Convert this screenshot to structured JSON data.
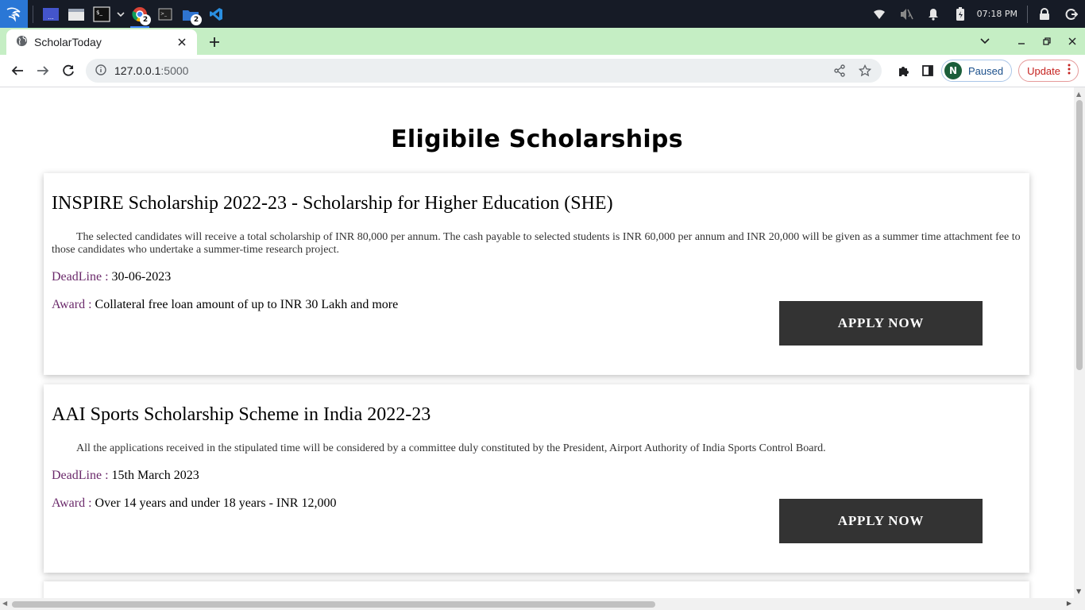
{
  "taskbar": {
    "clock": "07:18 PM",
    "apps": [
      {
        "name": "workspace-switcher",
        "badge": ""
      },
      {
        "name": "file-manager",
        "badge": ""
      },
      {
        "name": "terminal",
        "badge": ""
      },
      {
        "name": "chrome",
        "badge": "2"
      },
      {
        "name": "terminal-window",
        "badge": ""
      },
      {
        "name": "folder-window",
        "badge": "2"
      },
      {
        "name": "vscode",
        "badge": ""
      }
    ]
  },
  "browser": {
    "tab_title": "ScholarToday",
    "url_host": "127.0.0.1",
    "url_port": ":5000",
    "profile_initial": "N",
    "profile_status": "Paused",
    "update_label": "Update"
  },
  "page": {
    "title": "Eligibile Scholarships",
    "deadline_label": "DeadLine",
    "award_label": "Award",
    "apply_label": "APPLY NOW",
    "cards": [
      {
        "title": "INSPIRE Scholarship 2022-23 - Scholarship for Higher Education (SHE)",
        "description": "The selected candidates will receive a total scholarship of INR 80,000 per annum. The cash payable to selected students is INR 60,000 per annum and INR 20,000 will be given as a summer time attachment fee to those candidates who undertake a summer-time research project.",
        "deadline": "30-06-2023",
        "award": "Collateral free loan amount of up to INR 30 Lakh and more"
      },
      {
        "title": "AAI Sports Scholarship Scheme in India 2022-23",
        "description": "All the applications received in the stipulated time will be considered by a committee duly constituted by the President, Airport Authority of India Sports Control Board.",
        "deadline": "15th March 2023",
        "award": "Over 14 years and under 18 years - INR 12,000"
      }
    ]
  }
}
